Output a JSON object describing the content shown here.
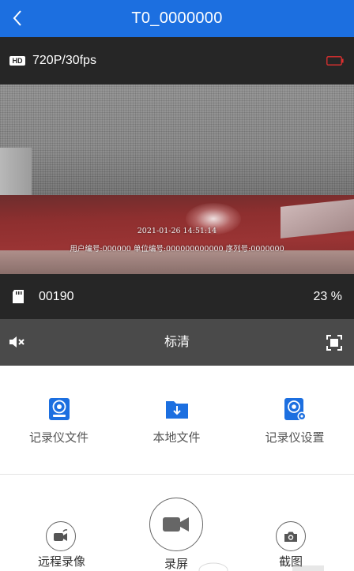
{
  "header": {
    "title": "T0_0000000",
    "back_icon": "chevron-left-icon",
    "color": "#1c6fe0"
  },
  "info": {
    "hd_badge": "HD",
    "resolution": "720P/30fps",
    "battery_icon": "battery-low-icon",
    "battery_color": "#e0302f"
  },
  "video": {
    "timestamp": "2021-01-26  14:51:14",
    "overlay": "用户编号:000000  单位编号:000000000000  序列号:0000000"
  },
  "status": {
    "sd_icon": "sd-card-icon",
    "count": "00190",
    "storage_percent": "23 %"
  },
  "controls": {
    "mute_icon": "mute-icon",
    "quality": "标清",
    "fullscreen_icon": "fullscreen-icon"
  },
  "actions": [
    {
      "label": "记录仪文件",
      "icon": "recorder-files-icon"
    },
    {
      "label": "本地文件",
      "icon": "local-folder-icon"
    },
    {
      "label": "记录仪设置",
      "icon": "recorder-settings-icon"
    }
  ],
  "bottom": {
    "remote_record": "远程录像",
    "record_screen": "录屏",
    "screenshot": "截图"
  },
  "accent": "#1c6fe0"
}
